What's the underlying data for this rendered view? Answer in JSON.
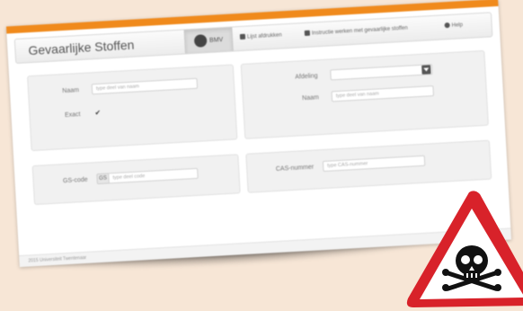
{
  "app": {
    "title": "Gevaarlijke Stoffen"
  },
  "nav": {
    "bmv": "BMV",
    "items": [
      {
        "label": "Lijst afdrukken",
        "icon": "print-icon"
      },
      {
        "label": "Instructie werken met gevaarlijke stoffen",
        "icon": "book-icon"
      },
      {
        "label": "Help",
        "icon": "help-icon"
      }
    ]
  },
  "search": {
    "naam_label": "Naam",
    "naam_placeholder": "type deel van naam",
    "exact_label": "Exact",
    "exact_checked": true,
    "afdeling_label": "Afdeling",
    "afdeling_value": "",
    "naam2_label": "Naam",
    "naam2_placeholder": "type deel van naam",
    "gs_label": "GS-code",
    "gs_prefix": "GS",
    "gs_placeholder": "type deel code",
    "cas_label": "CAS-nummer",
    "cas_placeholder": "type CAS-nummer"
  },
  "footer": {
    "text": "2015 Universiteit Twentenaar"
  },
  "colors": {
    "accent": "#f08a1c",
    "warning_red": "#d8222a"
  }
}
